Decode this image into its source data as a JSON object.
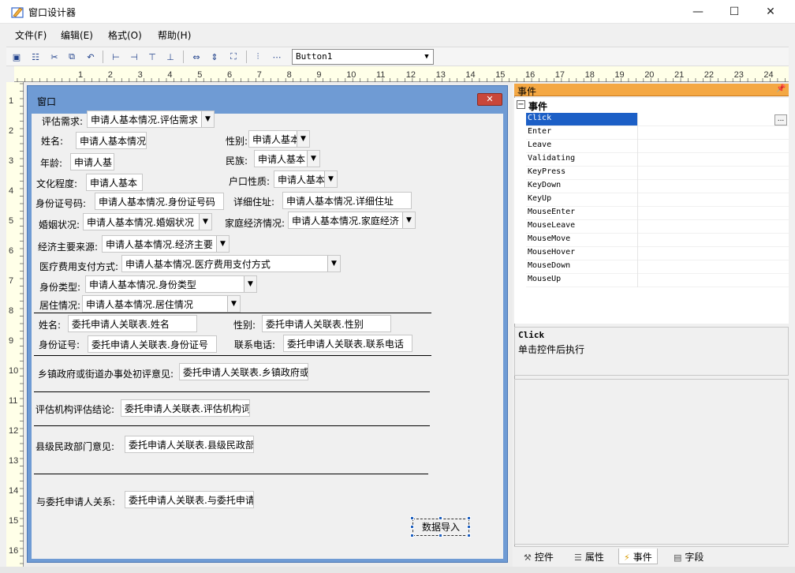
{
  "window": {
    "title": "窗口设计器",
    "minimize": "—",
    "maximize": "☐",
    "close": "✕"
  },
  "menu": [
    "文件(F)",
    "编辑(E)",
    "格式(O)",
    "帮助(H)"
  ],
  "toolbar": {
    "control_combo": "Button1"
  },
  "ruler": {
    "h": [
      "1",
      "2",
      "3",
      "4",
      "5",
      "6",
      "7",
      "8",
      "9",
      "10",
      "11",
      "12",
      "13",
      "14",
      "15",
      "16",
      "17",
      "18",
      "19",
      "20",
      "21",
      "22",
      "23",
      "24"
    ],
    "v": [
      "1",
      "2",
      "3",
      "4",
      "5",
      "6",
      "7",
      "8",
      "9",
      "10",
      "11",
      "12",
      "13",
      "14",
      "15",
      "16"
    ]
  },
  "form": {
    "title": "窗口",
    "fields": {
      "f1_label": "评估需求:",
      "f1_value": "申请人基本情况.评估需求",
      "f2_label": "姓名:",
      "f2_value": "申请人基本情况",
      "f3_label": "性别:",
      "f3_value": "申请人基本",
      "f4_label": "年龄:",
      "f4_value": "申请人基",
      "f5_label": "民族:",
      "f5_value": "申请人基本",
      "f6_label": "文化程度:",
      "f6_value": "申请人基本",
      "f7_label": "户口性质:",
      "f7_value": "申请人基本",
      "f8_label": "身份证号码:",
      "f8_value": "申请人基本情况.身份证号码",
      "f9_label": "详细住址:",
      "f9_value": "申请人基本情况.详细住址",
      "f10_label": "婚姻状况:",
      "f10_value": "申请人基本情况.婚姻状况",
      "f11_label": "家庭经济情况:",
      "f11_value": "申请人基本情况.家庭经济",
      "f12_label": "经济主要来源:",
      "f12_value": "申请人基本情况.经济主要",
      "f13_label": "医疗费用支付方式:",
      "f13_value": "申请人基本情况.医疗费用支付方式",
      "f14_label": "身份类型:",
      "f14_value": "申请人基本情况.身份类型",
      "f15_label": "居住情况:",
      "f15_value": "申请人基本情况.居住情况",
      "f16_label": "姓名:",
      "f16_value": "委托申请人关联表.姓名",
      "f17_label": "性别:",
      "f17_value": "委托申请人关联表.性别",
      "f18_label": "身份证号:",
      "f18_value": "委托申请人关联表.身份证号",
      "f19_label": "联系电话:",
      "f19_value": "委托申请人关联表.联系电话",
      "f20_label": "乡镇政府或街道办事处初评意见:",
      "f20_value": "委托申请人关联表.乡镇政府或",
      "f21_label": "评估机构评估结论:",
      "f21_value": "委托申请人关联表.评估机构词",
      "f22_label": "县级民政部门意见:",
      "f22_value": "委托申请人关联表.县级民政部",
      "f23_label": "与委托申请人关系:",
      "f23_value": "委托申请人关联表.与委托申请"
    },
    "button": "数据导入"
  },
  "events_panel": {
    "title": "事件",
    "category": "事件",
    "items": [
      "Click",
      "Enter",
      "Leave",
      "Validating",
      "KeyPress",
      "KeyDown",
      "KeyUp",
      "MouseEnter",
      "MouseLeave",
      "MouseMove",
      "MouseHover",
      "MouseDown",
      "MouseUp"
    ],
    "selected": "Click",
    "ellipsis": "...",
    "desc_title": "Click",
    "desc_text": "单击控件后执行",
    "tabs": [
      "控件",
      "属性",
      "事件",
      "字段"
    ],
    "active_tab": "事件"
  }
}
